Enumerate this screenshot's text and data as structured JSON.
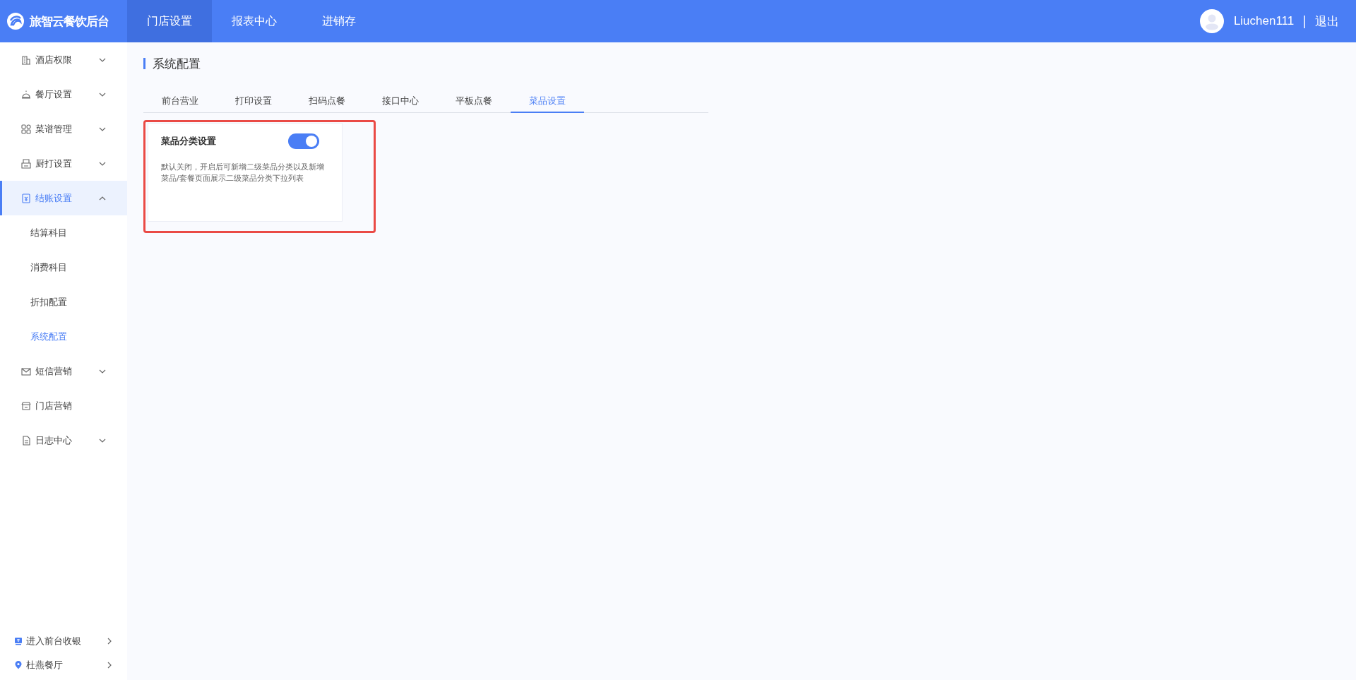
{
  "app": {
    "title": "旅智云餐饮后台"
  },
  "top_nav": [
    {
      "label": "门店设置",
      "selected": true
    },
    {
      "label": "报表中心",
      "selected": false
    },
    {
      "label": "进销存",
      "selected": false
    }
  ],
  "user": {
    "name": "Liuchen111",
    "separator": "|",
    "logout": "退出"
  },
  "sidebar": {
    "items": [
      {
        "label": "酒店权限",
        "expanded": false,
        "selected": false
      },
      {
        "label": "餐厅设置",
        "expanded": false,
        "selected": false
      },
      {
        "label": "菜谱管理",
        "expanded": false,
        "selected": false
      },
      {
        "label": "厨打设置",
        "expanded": false,
        "selected": false
      },
      {
        "label": "结账设置",
        "expanded": true,
        "selected": true,
        "children": [
          {
            "label": "结算科目",
            "selected": false
          },
          {
            "label": "消费科目",
            "selected": false
          },
          {
            "label": "折扣配置",
            "selected": false
          },
          {
            "label": "系统配置",
            "selected": true
          }
        ]
      },
      {
        "label": "短信营销",
        "expanded": false,
        "selected": false
      },
      {
        "label": "门店营销",
        "selected": false
      },
      {
        "label": "日志中心",
        "expanded": false,
        "selected": false
      }
    ],
    "footer_links": [
      {
        "label": "进入前台收银"
      },
      {
        "label": "杜燕餐厅"
      }
    ]
  },
  "page": {
    "title": "系统配置",
    "tabs": [
      {
        "label": "前台营业",
        "selected": false
      },
      {
        "label": "打印设置",
        "selected": false
      },
      {
        "label": "扫码点餐",
        "selected": false
      },
      {
        "label": "接口中心",
        "selected": false
      },
      {
        "label": "平板点餐",
        "selected": false
      },
      {
        "label": "菜品设置",
        "selected": true
      }
    ],
    "settings": [
      {
        "title": "菜品分类设置",
        "on": true,
        "description": "默认关闭，开启后可新增二级菜品分类以及新增菜品/套餐页面展示二级菜品分类下拉列表"
      }
    ]
  }
}
